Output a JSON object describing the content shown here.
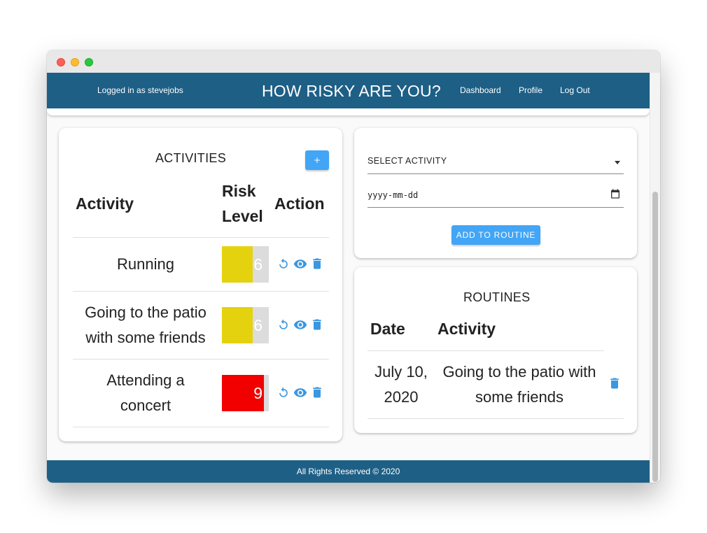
{
  "navbar": {
    "user_text": "Logged in as stevejobs",
    "title": "HOW RISKY ARE YOU?",
    "links": [
      "Dashboard",
      "Profile",
      "Log Out"
    ]
  },
  "activities": {
    "heading": "ACTIVITIES",
    "add_label": "+",
    "columns": [
      "Activity",
      "Risk Level",
      "Action"
    ],
    "column_lines": {
      "risk_1": "Risk",
      "risk_2": "Level"
    },
    "rows": [
      {
        "name_lines": [
          "Running"
        ],
        "risk": "6",
        "risk_fraction": 0.66,
        "risk_color": "#e5d20e"
      },
      {
        "name_lines": [
          "Going to the patio",
          "with some friends"
        ],
        "risk": "6",
        "risk_fraction": 0.66,
        "risk_color": "#e5d20e"
      },
      {
        "name_lines": [
          "Attending a",
          "concert"
        ],
        "risk": "9",
        "risk_fraction": 0.9,
        "risk_color": "#f20000"
      }
    ],
    "action_icons": [
      "refresh-icon",
      "eye-icon",
      "trash-icon"
    ]
  },
  "add_form": {
    "select_label": "SELECT ACTIVITY",
    "date_placeholder": "yyyy-mm-dd",
    "button_label": "ADD TO ROUTINE"
  },
  "routines": {
    "heading": "ROUTINES",
    "columns": [
      "Date",
      "Activity"
    ],
    "rows": [
      {
        "date_lines": [
          "July 10,",
          "2020"
        ],
        "activity_lines": [
          "Going to the patio with",
          "some friends"
        ]
      }
    ]
  },
  "footer": {
    "text": "All Rights Reserved © 2020"
  },
  "colors": {
    "navbar": "#1e5f86",
    "accent": "#42a5f5",
    "icon": "#3b97e0",
    "risk_medium": "#e5d20e",
    "risk_high": "#f20000"
  }
}
